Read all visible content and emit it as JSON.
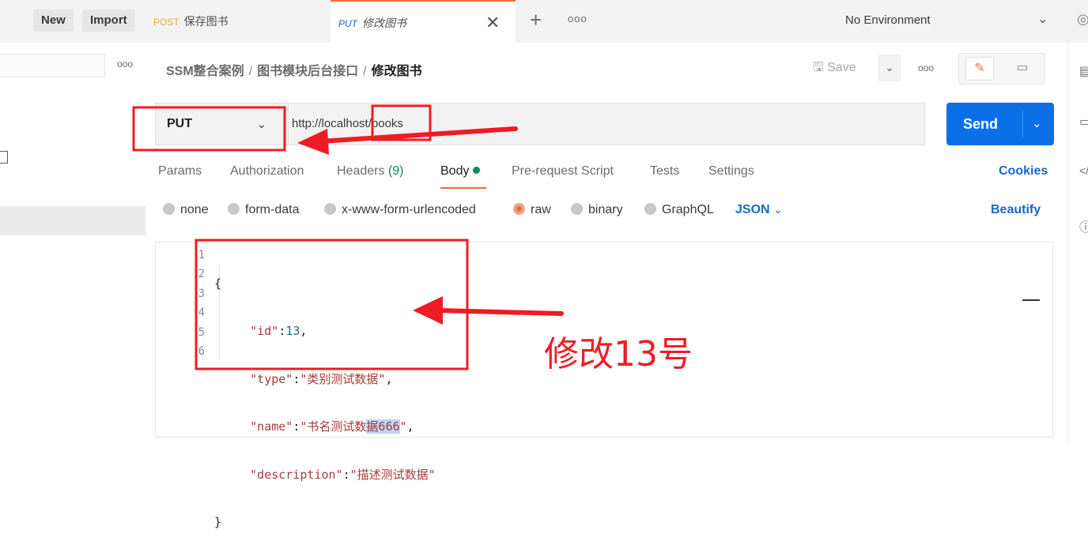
{
  "topbar": {
    "new_label": "New",
    "import_label": "Import",
    "tabs": [
      {
        "method": "POST",
        "title": "保存图书",
        "method_color": "#e8a93a"
      },
      {
        "method": "PUT",
        "title": "修改图书",
        "method_color": "#1769c9"
      }
    ],
    "environment": "No Environment"
  },
  "breadcrumb": {
    "parts": [
      "SSM整合案例",
      "图书模块后台接口",
      "修改图书"
    ],
    "separator": "/"
  },
  "toolbar": {
    "save_label": "Save"
  },
  "request": {
    "method": "PUT",
    "url": "http://localhost/books",
    "send_label": "Send"
  },
  "request_tabs": {
    "params": "Params",
    "authorization": "Authorization",
    "headers": "Headers",
    "headers_count": "(9)",
    "body": "Body",
    "prerequest": "Pre-request Script",
    "tests": "Tests",
    "settings": "Settings",
    "cookies": "Cookies"
  },
  "body_options": {
    "none": "none",
    "form_data": "form-data",
    "urlencoded": "x-www-form-urlencoded",
    "raw": "raw",
    "binary": "binary",
    "graphql": "GraphQL",
    "format": "JSON",
    "beautify": "Beautify"
  },
  "editor": {
    "line_numbers": [
      "1",
      "2",
      "3",
      "4",
      "5",
      "6"
    ],
    "open_brace": "{",
    "close_brace": "}",
    "id_key": "\"id\"",
    "id_value": "13",
    "type_key": "\"type\"",
    "type_value": "\"类别测试数据\"",
    "name_key": "\"name\"",
    "name_value_a": "\"书名测试数",
    "name_value_b": "据666",
    "name_value_c": "\"",
    "desc_key": "\"description\"",
    "desc_value": "\"描述测试数据\""
  },
  "annotation": {
    "text": "修改13号"
  },
  "colors": {
    "accent": "#f26b3a",
    "send": "#0b6fe8",
    "link": "#1769c9",
    "annotation": "#ee1c25"
  }
}
